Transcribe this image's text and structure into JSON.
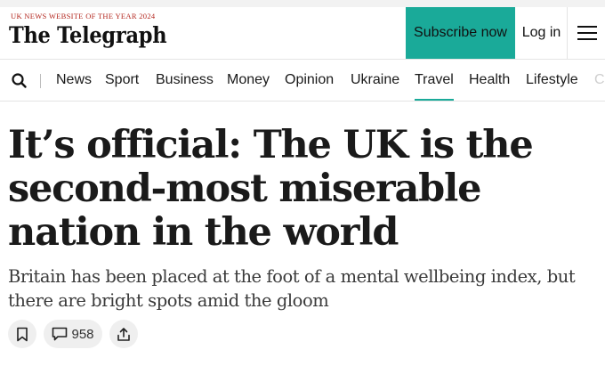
{
  "header": {
    "award": "UK NEWS WEBSITE OF THE YEAR 2024",
    "masthead": "The Telegraph",
    "subscribe_label": "Subscribe now",
    "login_label": "Log in"
  },
  "nav": {
    "items": [
      {
        "label": "News"
      },
      {
        "label": "Sport"
      },
      {
        "label": "Business"
      },
      {
        "label": "Money"
      },
      {
        "label": "Opinion"
      },
      {
        "label": "Ukraine"
      },
      {
        "label": "Travel",
        "active": true
      },
      {
        "label": "Health"
      },
      {
        "label": "Lifestyle"
      },
      {
        "label": "C"
      }
    ]
  },
  "article": {
    "headline": "It’s official: The UK is the second-most miserable nation in the world",
    "standfirst": "Britain has been placed at the foot of a mental wellbeing index, but there are bright spots amid the gloom",
    "comment_count": "958"
  },
  "colors": {
    "accent": "#1aaa99",
    "award_red": "#b3261e"
  },
  "icons": [
    "search-icon",
    "hamburger-menu-icon",
    "bookmark-icon",
    "comment-icon",
    "share-icon"
  ]
}
